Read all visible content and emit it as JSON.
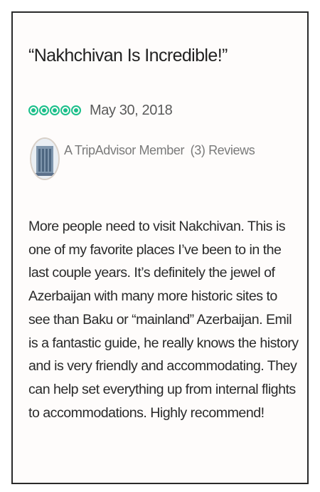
{
  "review": {
    "title": "“Nakhchivan Is Incredible!”",
    "rating": 5,
    "rating_max": 5,
    "rating_color": "#1bbf8a",
    "date": "May 30, 2018",
    "member": {
      "name": "A TripAdvisor Member",
      "reviews": "(3) Reviews",
      "avatar_icon": "building-avatar-icon"
    },
    "body_lines": [
      "More people need to visit Nakchivan.  This is",
      "one of my favorite places I’ve been to in the",
      "last couple years.  It’s definitely the jewel of",
      "Azerbaijan with many more historic sites to",
      "see than Baku or “mainland” Azerbaijan.  Emil",
      "is a fantastic guide, he really knows the history",
      "and is very friendly and accommodating.  They",
      "can help set everything up from internal flights",
      "to accommodations.  Highly recommend!"
    ]
  }
}
